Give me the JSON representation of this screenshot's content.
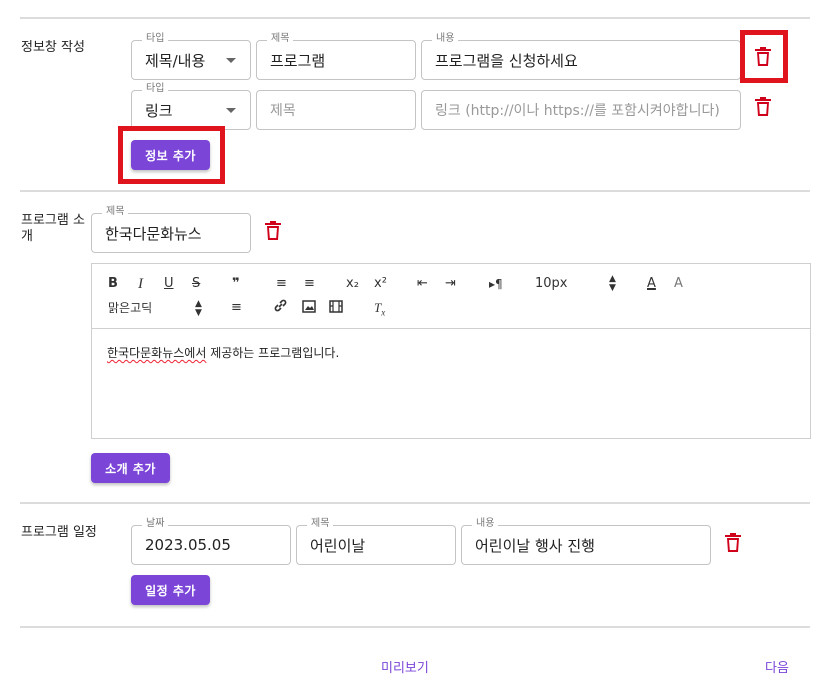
{
  "info_section": {
    "label": "정보창 작성",
    "rows": [
      {
        "type_label": "타입",
        "type_value": "제목/내용",
        "title_label": "제목",
        "title_value": "프로그램",
        "content_label": "내용",
        "content_value": "프로그램을 신청하세요"
      },
      {
        "type_label": "타입",
        "type_value": "링크",
        "title_placeholder": "제목",
        "link_placeholder": "링크 (http://이나 https://를 포함시켜야합니다)"
      }
    ],
    "add_button": "정보 추가"
  },
  "intro_section": {
    "label": "프로그램 소개",
    "title_label": "제목",
    "title_value": "한국다문화뉴스",
    "toolbar": {
      "bold": "B",
      "italic": "I",
      "underline": "U",
      "strike": "S",
      "quote": "❞",
      "ol": "≡",
      "ul": "≡",
      "subscript": "x₂",
      "superscript": "x²",
      "outdent": "⇤",
      "indent": "⇥",
      "rtl": "▸¶",
      "font_size": "10px",
      "font_family": "맑은고딕",
      "align": "≡",
      "link": "🔗",
      "image": "▣",
      "video": "▦",
      "clear": "Tx"
    },
    "body_underlined": "한국다문화뉴스에서",
    "body_rest": " 제공하는 프로그램입니다.",
    "add_button": "소개 추가"
  },
  "schedule_section": {
    "label": "프로그램 일정",
    "date_label": "날짜",
    "date_value": "2023.05.05",
    "title_label": "제목",
    "title_value": "어린이날",
    "content_label": "내용",
    "content_value": "어린이날 행사 진행",
    "add_button": "일정 추가"
  },
  "footer": {
    "preview": "미리보기",
    "next": "다음"
  },
  "colors": {
    "accent": "#7b45d8",
    "danger": "#d0021b",
    "highlight": "#e0141c"
  }
}
